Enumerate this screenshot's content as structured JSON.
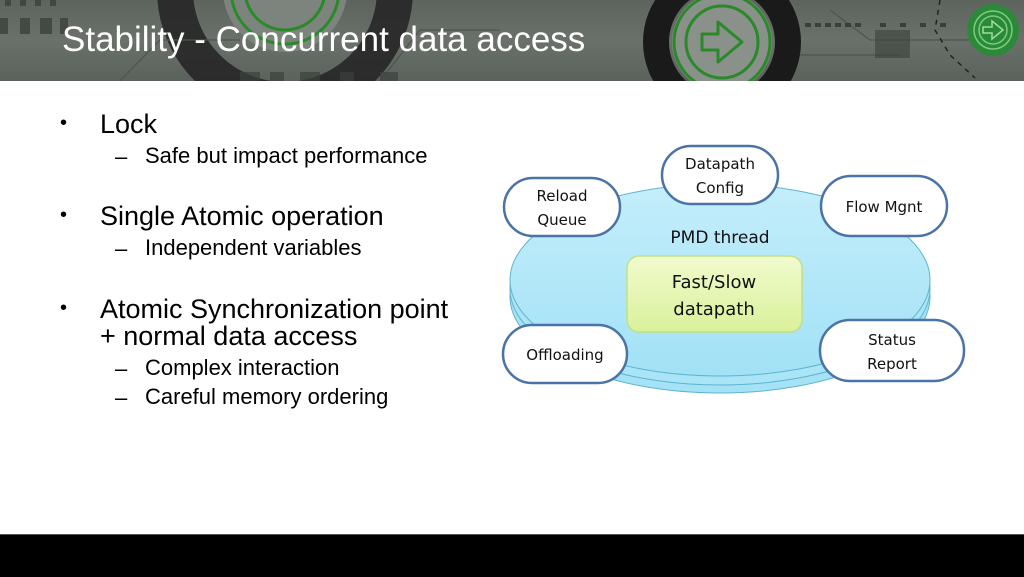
{
  "slide": {
    "title": "Stability - Concurrent data access"
  },
  "bullets": [
    {
      "marker": "•",
      "lines": [
        "Lock"
      ],
      "subs": [
        {
          "marker": "–",
          "text": "Safe but impact performance"
        }
      ]
    },
    {
      "marker": "•",
      "lines": [
        "Single Atomic operation"
      ],
      "subs": [
        {
          "marker": "–",
          "text": "Independent variables"
        }
      ]
    },
    {
      "marker": "•",
      "lines": [
        "Atomic Synchronization point",
        "+ normal data access"
      ],
      "subs": [
        {
          "marker": "–",
          "text": "Complex interaction"
        },
        {
          "marker": "–",
          "text": "Careful memory ordering"
        }
      ]
    }
  ],
  "diagram": {
    "platter_label": "PMD thread",
    "center": {
      "line1": "Fast/Slow",
      "line2": "datapath"
    },
    "pills": {
      "datapath_config": {
        "line1": "Datapath",
        "line2": "Config"
      },
      "reload_queue": {
        "line1": "Reload",
        "line2": "Queue"
      },
      "flow_mgnt": {
        "line1": "Flow Mgnt"
      },
      "offloading": {
        "line1": "Offloading"
      },
      "status_report": {
        "line1": "Status",
        "line2": "Report"
      }
    },
    "colors": {
      "platter_fill": "#a9e4f7",
      "platter_edge": "#5fb4cf",
      "pill_border": "#4a73a8",
      "center_fill": "#e6f7b5",
      "center_border": "#b9d97a"
    }
  },
  "banner": {
    "icons": [
      "arrow-circle-icon",
      "arrow-circle-badge-icon"
    ]
  }
}
